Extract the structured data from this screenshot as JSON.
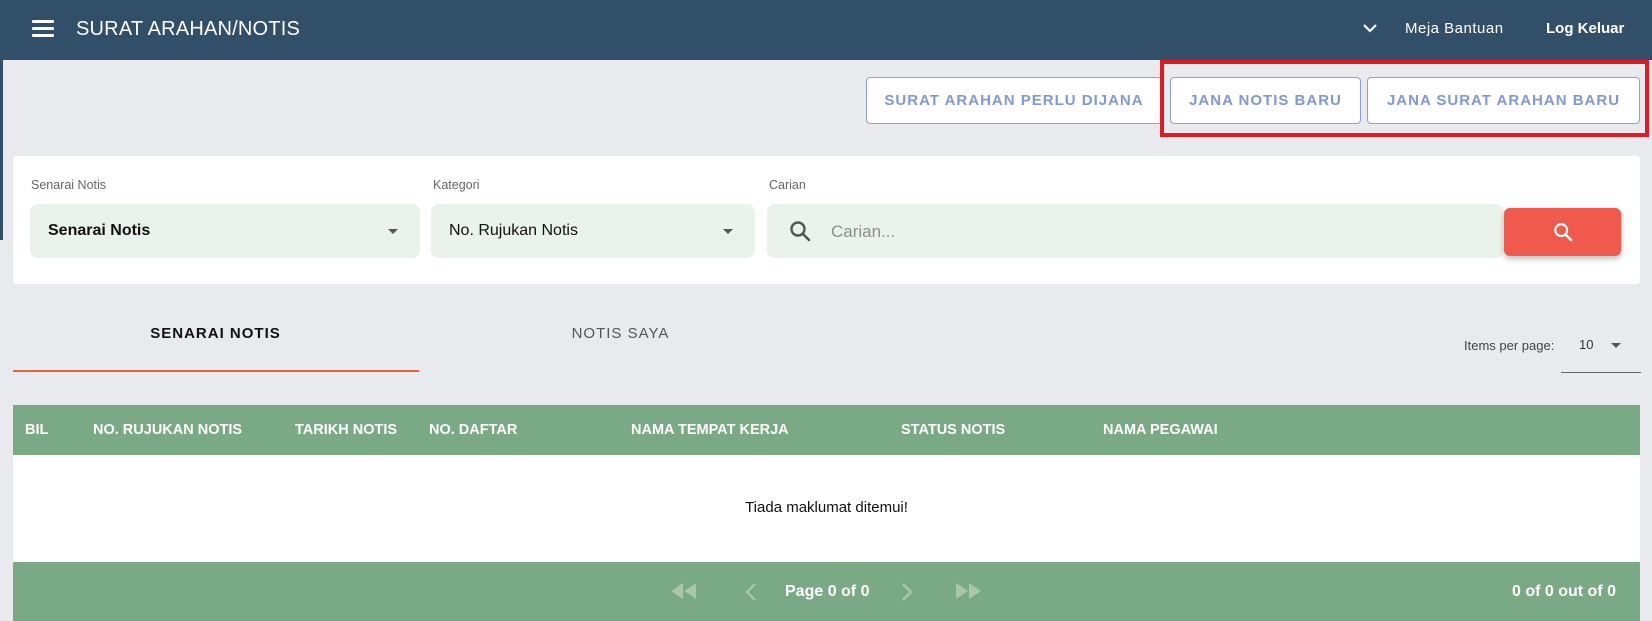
{
  "header": {
    "title": "SURAT ARAHAN/NOTIS",
    "help_link": "Meja Bantuan",
    "logout_link": "Log Keluar"
  },
  "actions": {
    "dijana_label": "SURAT ARAHAN PERLU DIJANA",
    "jana_notis_label": "JANA NOTIS BARU",
    "jana_surat_label": "JANA SURAT ARAHAN BARU"
  },
  "filters": {
    "senarai": {
      "label": "Senarai Notis",
      "value": "Senarai Notis"
    },
    "kategori": {
      "label": "Kategori",
      "value": "No. Rujukan Notis"
    },
    "carian": {
      "label": "Carian",
      "placeholder": "Carian..."
    }
  },
  "tabs": [
    {
      "label": "SENARAI NOTIS",
      "active": true
    },
    {
      "label": "NOTIS SAYA",
      "active": false
    }
  ],
  "pagination": {
    "items_per_page_label": "Items per page:",
    "items_per_page": "10",
    "page_text": "Page 0 of 0",
    "range_text": "0 of 0 out of 0"
  },
  "table": {
    "columns": [
      "BIL",
      "NO. RUJUKAN NOTIS",
      "TARIKH NOTIS",
      "NO. DAFTAR",
      "NAMA TEMPAT KERJA",
      "STATUS NOTIS",
      "NAMA PEGAWAI"
    ],
    "empty_message": "Tiada maklumat ditemui!"
  },
  "colors": {
    "header_bg": "#324f69",
    "table_green": "#7aa985",
    "search_button": "#f05a4d",
    "outline_button": "#8aa1de",
    "highlight": "#e01b24",
    "tab_underline": "#e8623f"
  },
  "icons": {
    "menu": "menu-icon",
    "chevron": "chevron-down-icon",
    "search": "search-icon",
    "first": "first-page-icon",
    "prev": "prev-page-icon",
    "next": "next-page-icon",
    "last": "last-page-icon"
  }
}
